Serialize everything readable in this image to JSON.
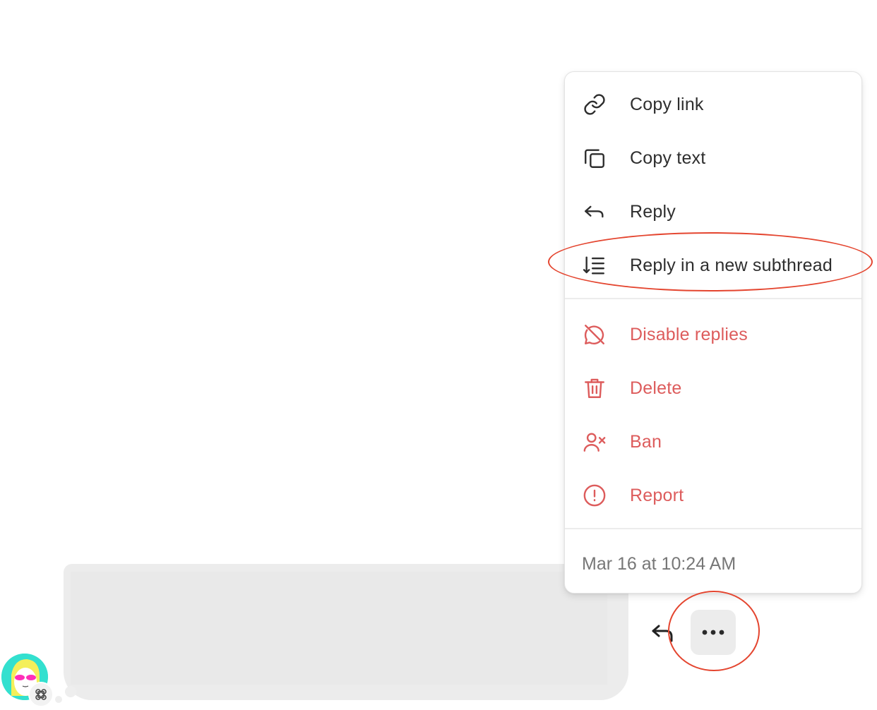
{
  "context_menu": {
    "items": [
      {
        "label": "Copy link",
        "icon": "link-icon",
        "tone": "neutral"
      },
      {
        "label": "Copy text",
        "icon": "copy-icon",
        "tone": "neutral"
      },
      {
        "label": "Reply",
        "icon": "reply-icon",
        "tone": "neutral"
      },
      {
        "label": "Reply in a new subthread",
        "icon": "subthread-icon",
        "tone": "neutral"
      }
    ],
    "danger_items": [
      {
        "label": "Disable replies",
        "icon": "comment-off-icon",
        "tone": "danger"
      },
      {
        "label": "Delete",
        "icon": "trash-icon",
        "tone": "danger"
      },
      {
        "label": "Ban",
        "icon": "user-x-icon",
        "tone": "danger"
      },
      {
        "label": "Report",
        "icon": "alert-circle-icon",
        "tone": "danger"
      }
    ],
    "timestamp": "Mar 16 at 10:24 AM"
  },
  "message_actions": {
    "reply_icon": "reply-arrow-icon",
    "more_icon": "more-horizontal-icon"
  },
  "colors": {
    "danger": "#dd5c5c",
    "neutral_text": "#2e2e2e",
    "annotation": "#e4452f",
    "bubble": "#ececec",
    "avatar_bg": "#33e0cf"
  }
}
